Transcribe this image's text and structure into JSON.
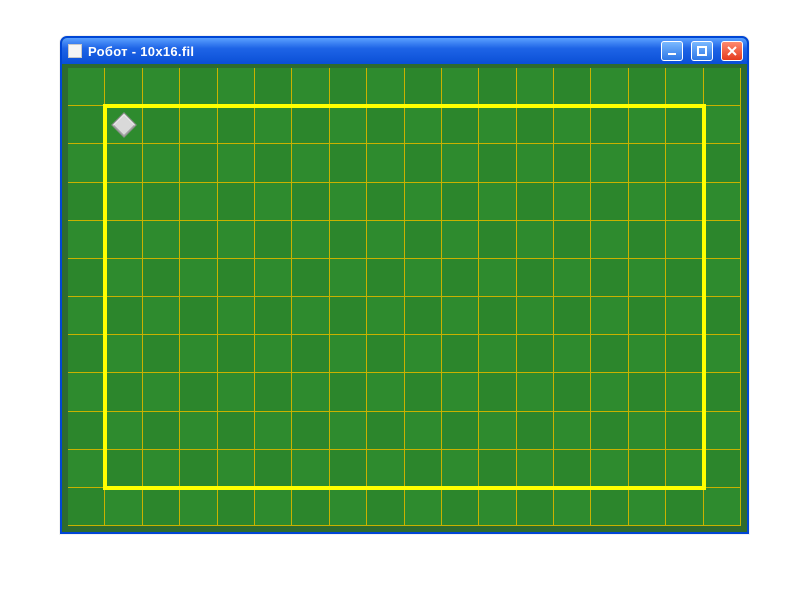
{
  "window": {
    "title": "Робот - 10x16.fil"
  },
  "grid": {
    "cols": 18,
    "rows": 12
  },
  "frame_inset_cells": {
    "left": 1,
    "top": 1,
    "right": 1,
    "bottom": 1
  },
  "robot_cell": {
    "col": 1,
    "row": 1
  },
  "colors": {
    "field": "#2e8b2e",
    "grid_line": "#c8b200",
    "frame": "#ffff00",
    "titlebar_text": "#ffffff"
  }
}
